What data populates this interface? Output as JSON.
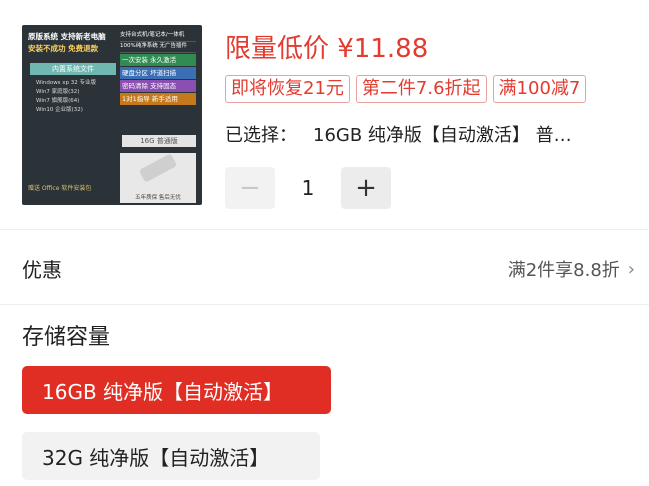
{
  "product": {
    "image": {
      "banner_line1": "原版系统  支持新老电脑",
      "banner_line2": "安装不成功  免费退款",
      "pill": "内置系统文件",
      "os_list": [
        "Windows xp 32 专业版",
        "Win7 家庭版(32)",
        "Win7 旗舰版(64)",
        "Win10 企业版(32)"
      ],
      "feature_top": "支持台式机/笔记本/一体机",
      "feature_top2": "100%纯净系统 无广告插件",
      "features": [
        "一次安装  永久激活",
        "硬盘分区  坏道扫描",
        "密码清除  支持固态",
        "1对1指导  新手适用"
      ],
      "capacity": "16G 普通版",
      "usb_caption": "五年质保  售后无忧",
      "office": "赠送 Office 软件安装包"
    },
    "price": "限量低价 ¥11.88",
    "tags": [
      "即将恢复21元",
      "第二件7.6折起",
      "满100减7"
    ],
    "selected_label": "已选择：",
    "selected_value": "16GB 纯净版【自动激活】 普…",
    "quantity": "1",
    "minus_label": "−",
    "plus_label": "+"
  },
  "discount": {
    "label": "优惠",
    "value": "满2件享8.8折",
    "chevron": "›"
  },
  "storage": {
    "label": "存储容量",
    "options": [
      {
        "label": "16GB 纯净版【自动激活】",
        "selected": true
      },
      {
        "label": "32G 纯净版【自动激活】",
        "selected": false
      }
    ]
  },
  "colors": {
    "accent": "#e02e24",
    "price": "#e23b30"
  }
}
